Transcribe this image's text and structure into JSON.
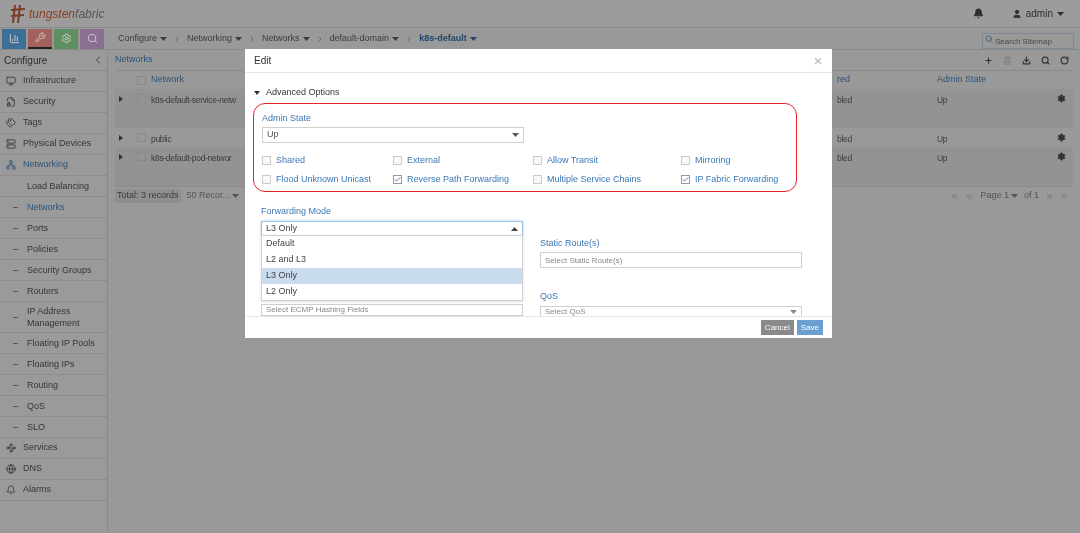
{
  "header": {
    "logo": {
      "part1": "tungsten",
      "part2": "fabric"
    },
    "user": "admin"
  },
  "nav_buttons": [
    {
      "selected": false,
      "color": "#3e6f96"
    },
    {
      "selected": true,
      "color": "#a4625c"
    },
    {
      "selected": false,
      "color": "#5f8f5e"
    },
    {
      "selected": false,
      "color": "#8b6f93"
    }
  ],
  "breadcrumb": [
    {
      "label": "Configure",
      "current": false
    },
    {
      "label": "Networking",
      "current": false
    },
    {
      "label": "Networks",
      "current": false
    },
    {
      "label": "default-domain",
      "current": false
    },
    {
      "label": "k8s-default",
      "current": true
    }
  ],
  "search": {
    "placeholder": "Search Sitemap"
  },
  "sidebar": {
    "title": "Configure",
    "items": [
      {
        "label": "Infrastructure",
        "selected": false
      },
      {
        "label": "Security",
        "selected": false
      },
      {
        "label": "Tags",
        "selected": false
      },
      {
        "label": "Physical Devices",
        "selected": false
      },
      {
        "label": "Networking",
        "selected": true,
        "children": [
          {
            "label": "Load Balancing",
            "kind": "group",
            "selected": false
          },
          {
            "label": "Networks",
            "kind": "link",
            "selected": true
          },
          {
            "label": "Ports",
            "kind": "link",
            "selected": false
          },
          {
            "label": "Policies",
            "kind": "link",
            "selected": false
          },
          {
            "label": "Security Groups",
            "kind": "link",
            "selected": false
          },
          {
            "label": "Routers",
            "kind": "link",
            "selected": false
          },
          {
            "label": "IP Address Management",
            "kind": "link",
            "selected": false
          },
          {
            "label": "Floating IP Pools",
            "kind": "link",
            "selected": false
          },
          {
            "label": "Floating IPs",
            "kind": "link",
            "selected": false
          },
          {
            "label": "Routing",
            "kind": "link",
            "selected": false
          },
          {
            "label": "QoS",
            "kind": "link",
            "selected": false
          },
          {
            "label": "SLO",
            "kind": "link",
            "selected": false
          }
        ]
      },
      {
        "label": "Services",
        "selected": false
      },
      {
        "label": "DNS",
        "selected": false
      },
      {
        "label": "Alarms",
        "selected": false
      }
    ]
  },
  "table": {
    "title": "Networks",
    "select_all": {
      "checked": false
    },
    "columns": [
      "Network",
      "red",
      "Admin State"
    ],
    "rows": [
      {
        "cells": [
          "k8s-default-service-netw",
          "bled",
          "Up"
        ],
        "tall": true,
        "checked": false
      },
      {
        "cells": [
          "public",
          "bled",
          "Up"
        ],
        "tall": false,
        "checked": false
      },
      {
        "cells": [
          "k8s-default-pod-networ",
          "bled",
          "Up"
        ],
        "tall": true,
        "checked": false
      }
    ],
    "footer": {
      "total": "Total: 3 records",
      "page_size": "50 Recor...",
      "page": "Page 1",
      "of": "of 1"
    }
  },
  "modal": {
    "title": "Edit",
    "section": {
      "label": "Advanced Options",
      "expanded": true
    },
    "admin_state": {
      "label": "Admin State",
      "value": "Up"
    },
    "checkboxes": [
      {
        "label": "Shared",
        "checked": false
      },
      {
        "label": "External",
        "checked": false
      },
      {
        "label": "Allow Transit",
        "checked": false
      },
      {
        "label": "Mirroring",
        "checked": false
      },
      {
        "label": "Flood Unknown Unicast",
        "checked": false
      },
      {
        "label": "Reverse Path Forwarding",
        "checked": true
      },
      {
        "label": "Multiple Service Chains",
        "checked": false
      },
      {
        "label": "IP Fabric Forwarding",
        "checked": true
      }
    ],
    "forwarding_mode": {
      "label": "Forwarding Mode",
      "value": "L3 Only",
      "expanded": true,
      "options": [
        {
          "label": "Default",
          "selected": false
        },
        {
          "label": "L2 and L3",
          "selected": false
        },
        {
          "label": "L3 Only",
          "selected": true
        },
        {
          "label": "L2 Only",
          "selected": false
        }
      ]
    },
    "ecmp": {
      "placeholder": "Select ECMP Hashing Fields"
    },
    "static_routes": {
      "label": "Static Route(s)",
      "placeholder": "Select Static Route(s)"
    },
    "qos": {
      "label": "QoS",
      "placeholder": "Select QoS"
    },
    "buttons": {
      "cancel": "Cancel",
      "save": "Save"
    }
  }
}
